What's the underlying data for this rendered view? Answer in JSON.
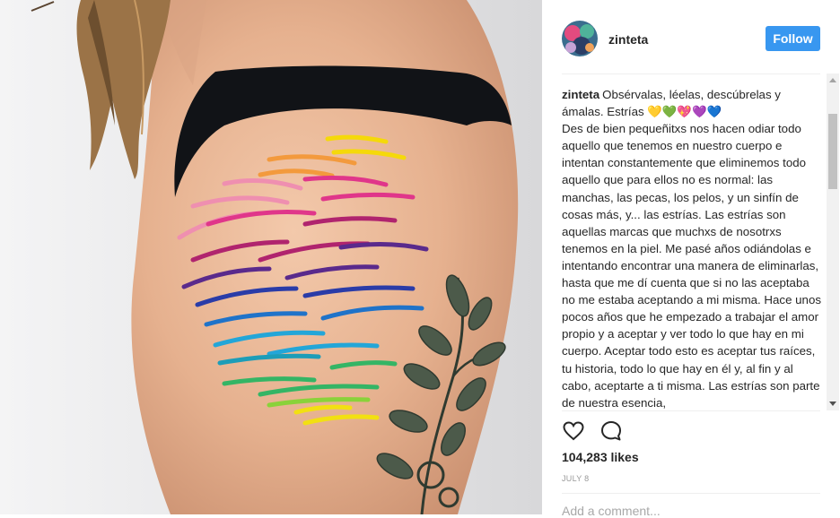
{
  "post": {
    "photo_alt": "",
    "username": "zinteta",
    "follow_label": "Follow",
    "caption_author": "zinteta",
    "caption_paragraphs": [
      "Obsérvalas, léelas, descúbrelas y ámalas. Estrías 💛💚💖💜💙",
      "Des de bien pequeñitxs nos hacen odiar todo aquello que tenemos en nuestro cuerpo e intentan constantemente que eliminemos todo aquello que para ellos no es normal: las manchas, las pecas, los pelos, y un sinfín de cosas más, y... las estrías. Las estrías son aquellas marcas que muchxs de nosotrxs tenemos en la piel. Me pasé años odiándolas e intentando encontrar una manera de eliminarlas, hasta que me dí cuenta que si no las aceptaba no me estaba aceptando a mi misma. Hace unos pocos años que he empezado a trabajar el amor propio y a aceptar y ver todo lo que hay en mi cuerpo. Aceptar todo esto es aceptar tus raíces, tu historia, todo lo que hay en él y, al fin y al cabo, aceptarte a ti misma. Las estrías son parte de nuestra esencia,"
    ],
    "likes_text": "104,283 likes",
    "date_text": "JULY 8",
    "add_comment_placeholder": "Add a comment..."
  },
  "icons": {
    "like": "heart-outline-icon",
    "comment": "speech-bubble-icon"
  },
  "colors": {
    "follow_button": "#3897f0",
    "text": "#262626",
    "muted": "#999999",
    "divider": "#efefef",
    "stripes": [
      "#f5d90a",
      "#f39a3d",
      "#ef8fb0",
      "#e0368a",
      "#b0246e",
      "#5a2a8c",
      "#2a3ca8",
      "#1f73c9",
      "#23a6d8",
      "#34b565",
      "#8ad23a",
      "#f2e012"
    ]
  }
}
